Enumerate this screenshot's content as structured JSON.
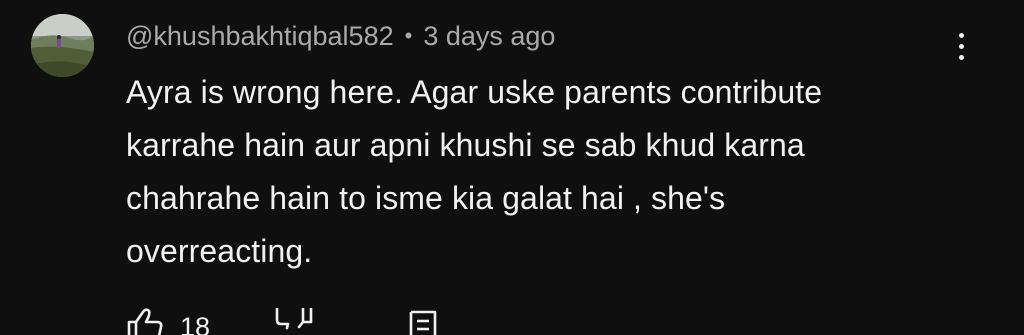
{
  "comment": {
    "author": "@khushbakhtiqbal582",
    "separator": "•",
    "timestamp": "3 days ago",
    "lines": [
      "Ayra is wrong here. Agar uske parents contribute",
      "karrahe hain aur apni khushi se sab khud karna",
      "chahrahe hain to isme kia galat hai , she's",
      "overreacting."
    ],
    "like_count": "18"
  },
  "icons": {
    "avatar": "avatar-photo",
    "more": "more-vert-icon",
    "like": "thumb-up-icon",
    "dislike": "thumb-down-icon",
    "reply": "reply-comment-icon"
  },
  "colors": {
    "background": "#0f0f0f",
    "primary_text": "#f1f1f1",
    "secondary_text": "#aaaaaa"
  }
}
